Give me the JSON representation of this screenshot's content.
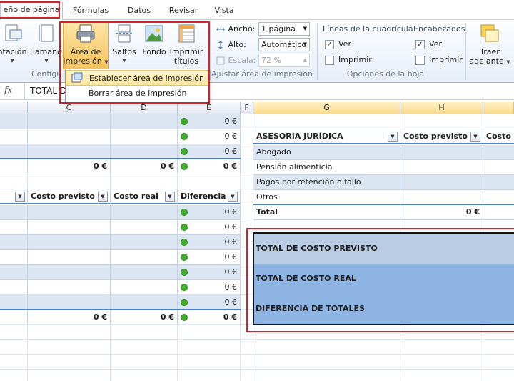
{
  "tabs": [
    {
      "label": "eño de página",
      "active": true
    },
    {
      "label": "Fórmulas"
    },
    {
      "label": "Datos"
    },
    {
      "label": "Revisar"
    },
    {
      "label": "Vista"
    }
  ],
  "ribbon": {
    "groups": {
      "config": "Configu",
      "fit": "Ajustar área de impresión",
      "sheet": "Opciones de la hoja"
    },
    "buttons": {
      "orientation": "ntación",
      "size": "Tamaño",
      "print_area_l1": "Área de",
      "print_area_l2": "impresión",
      "breaks": "Saltos",
      "background": "Fondo",
      "titles_l1": "Imprimir",
      "titles_l2": "títulos",
      "bring_l1": "Traer",
      "bring_l2": "adelante"
    },
    "fit": {
      "width_label": "Ancho:",
      "width_value": "1 página",
      "height_label": "Alto:",
      "height_value": "Automático",
      "scale_label": "Escala:",
      "scale_value": "72 %"
    },
    "gridlines": {
      "title": "Líneas de la cuadrícula",
      "view": "Ver",
      "print": "Imprimir",
      "view_checked": true,
      "print_checked": false
    },
    "headings": {
      "title": "Encabezados",
      "view": "Ver",
      "print": "Imprimir",
      "view_checked": true,
      "print_checked": false
    }
  },
  "dropdown": {
    "items": [
      "Establecer área de impresión",
      "Borrar área de impresión"
    ]
  },
  "formula_bar": {
    "fx": "fx",
    "value": "TOTAL D"
  },
  "columns": [
    "C",
    "D",
    "E",
    "F",
    "G",
    "H"
  ],
  "left_table": {
    "top_rows": [
      {
        "e": "0 €"
      },
      {
        "e": "0 €"
      },
      {
        "e": "0 €"
      }
    ],
    "top_total": {
      "c": "0 €",
      "d": "0 €",
      "e": "0 €"
    },
    "headers": [
      "Costo previsto",
      "Costo real",
      "Diferencia"
    ],
    "rows": [
      "0 €",
      "0 €",
      "0 €",
      "0 €",
      "0 €",
      "0 €",
      "0 €"
    ],
    "total": {
      "c": "0 €",
      "d": "0 €",
      "e": "0 €"
    }
  },
  "right_table": {
    "headers": [
      "ASESORÍA JURÍDICA",
      "Costo previsto",
      "Costo r"
    ],
    "rows": [
      "Abogado",
      "Pensión alimenticia",
      "Pagos por retención o fallo",
      "Otros"
    ],
    "total_label": "Total",
    "total_value": "0 €"
  },
  "summary": {
    "rows": [
      "TOTAL DE COSTO PREVISTO",
      "TOTAL DE COSTO REAL",
      "DIFERENCIA DE TOTALES"
    ],
    "colors": [
      "#b8cce4",
      "#8db4e2",
      "#8db4e2"
    ]
  }
}
